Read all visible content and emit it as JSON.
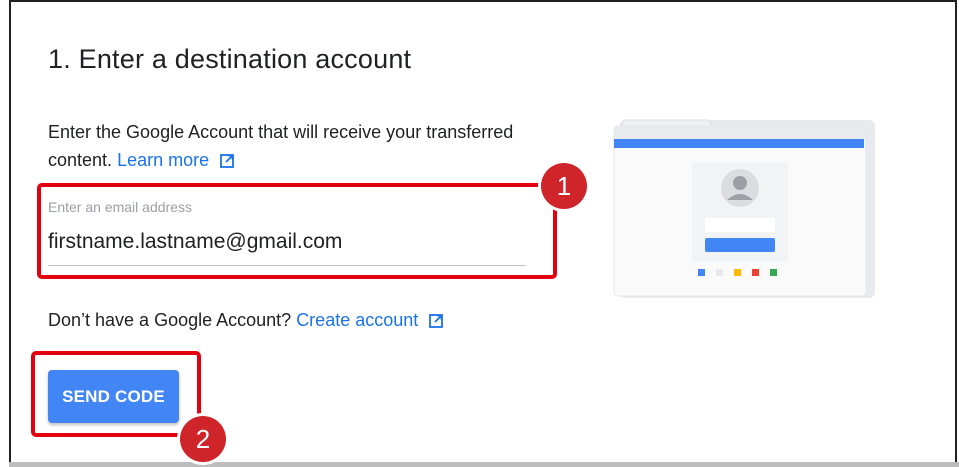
{
  "step": {
    "title": "1. Enter a destination account",
    "description": "Enter the Google Account that will receive your transferred content.",
    "learn_more": "Learn more"
  },
  "email": {
    "label": "Enter an email address",
    "value": "firstname.lastname@gmail.com"
  },
  "no_account": {
    "text": "Don’t have a Google Account?",
    "link": "Create account"
  },
  "send_button": {
    "label": "SEND CODE"
  },
  "callouts": {
    "first": "1",
    "second": "2"
  },
  "colors": {
    "accent": "#1a73e8",
    "button": "#4285f4",
    "callout": "#d0242b",
    "highlight": "#e3000f"
  },
  "icons": {
    "external_link": "open-in-new-icon",
    "illustration": "account-transfer-illustration"
  }
}
